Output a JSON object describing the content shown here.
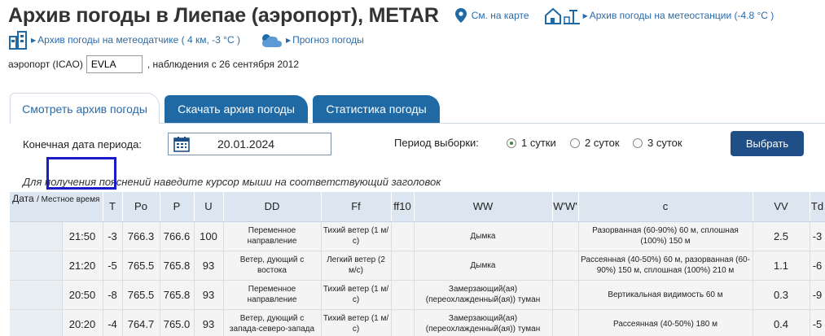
{
  "header": {
    "title": "Архив погоды в Лиепае (аэропорт), METAR",
    "map_link": "См. на карте",
    "station_link": "Архив погоды на метеостанции (-4.8 °C )",
    "sensor_link": "Архив погоды на метеодатчике ( 4 км, -3 °C )",
    "forecast_link": "Прогноз погоды"
  },
  "airport": {
    "label": "аэропорт (ICAO)",
    "code": "EVLA",
    "observations": ", наблюдения с 26 сентября 2012"
  },
  "tabs": [
    {
      "label": "Смотреть архив погоды",
      "active": true
    },
    {
      "label": "Скачать архив погоды",
      "active": false
    },
    {
      "label": "Статистика погоды",
      "active": false
    }
  ],
  "form": {
    "end_date_label": "Конечная дата периода:",
    "end_date": "20.01.2024",
    "period_label": "Период выборки:",
    "options": [
      "1 сутки",
      "2 суток",
      "3 суток"
    ],
    "selected_option": "1 сутки",
    "submit_label": "Выбрать"
  },
  "hint": "Для получения пояснений наведите курсор мыши на соответствующий заголовок",
  "table": {
    "head_date": "Дата",
    "head_local": "/ Местное время",
    "columns": [
      "T",
      "Po",
      "P",
      "U",
      "DD",
      "Ff",
      "ff10",
      "WW",
      "W'W'",
      "c",
      "VV",
      "Td"
    ],
    "rows": [
      {
        "time": "21:50",
        "T": "-3",
        "Po": "766.3",
        "P": "766.6",
        "U": "100",
        "DD": "Переменное направление",
        "Ff": "Тихий ветер (1 м/с)",
        "ff10": "",
        "WW": "Дымка",
        "W'W'": "",
        "c": "Разорванная (60-90%) 60 м, сплошная (100%) 150 м",
        "VV": "2.5",
        "Td": "-3"
      },
      {
        "time": "21:20",
        "T": "-5",
        "Po": "765.5",
        "P": "765.8",
        "U": "93",
        "DD": "Ветер, дующий с востока",
        "Ff": "Легкий ветер (2 м/с)",
        "ff10": "",
        "WW": "Дымка",
        "W'W'": "",
        "c": "Рассеянная (40-50%) 60 м, разорванная (60-90%) 150 м, сплошная (100%) 210 м",
        "VV": "1.1",
        "Td": "-6"
      },
      {
        "time": "20:50",
        "T": "-8",
        "Po": "765.5",
        "P": "765.8",
        "U": "93",
        "DD": "Переменное направление",
        "Ff": "Тихий ветер (1 м/с)",
        "ff10": "",
        "WW": "Замерзающий(ая) (переохлажденный(ая)) туман",
        "W'W'": "",
        "c": "Вертикальная видимость 60 м",
        "VV": "0.3",
        "Td": "-9"
      },
      {
        "time": "20:20",
        "T": "-4",
        "Po": "764.7",
        "P": "765.0",
        "U": "93",
        "DD": "Ветер, дующий с запада-северо-запада",
        "Ff": "Тихий ветер (1 м/с)",
        "ff10": "",
        "WW": "Замерзающий(ая) (переохлажденный(ая)) туман",
        "W'W'": "",
        "c": "Рассеянная (40-50%) 180 м",
        "VV": "0.4",
        "Td": "-5"
      }
    ]
  },
  "colors": {
    "accent": "#1f6aa5",
    "button": "#1f4f86",
    "highlight": "#1a1ac8",
    "header_bg": "#dbe6f0"
  }
}
